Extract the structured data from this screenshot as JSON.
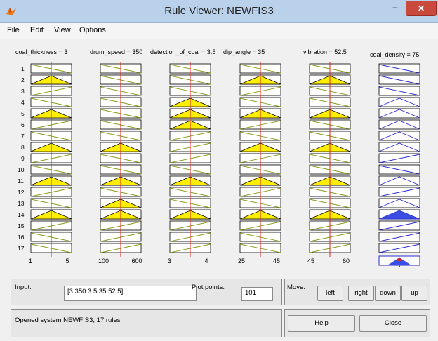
{
  "window": {
    "title": "Rule Viewer: NEWFIS3",
    "controls": {
      "minimize": "–",
      "maximize": "□",
      "close": "✕"
    }
  },
  "menu": [
    "File",
    "Edit",
    "View",
    "Options"
  ],
  "rule_count": 17,
  "inputs": [
    {
      "label": "coal_thickness = 3",
      "min": "1",
      "max": "5",
      "value": 3,
      "range": [
        1,
        5
      ]
    },
    {
      "label": "drum_speed = 350",
      "min": "100",
      "max": "600",
      "value": 350,
      "range": [
        100,
        600
      ]
    },
    {
      "label": "detection_of_coal = 3.5",
      "min": "3",
      "max": "4",
      "value": 3.5,
      "range": [
        3,
        4
      ]
    },
    {
      "label": "dip_angle = 35",
      "min": "25",
      "max": "45",
      "value": 35,
      "range": [
        25,
        45
      ]
    },
    {
      "label": "vibration = 52.5",
      "min": "45",
      "max": "60",
      "value": 52.5,
      "range": [
        45,
        60
      ]
    }
  ],
  "output": {
    "label": "coal_density = 75"
  },
  "rules_mf": [
    [
      "low",
      "low",
      "low",
      "low",
      "low"
    ],
    [
      "med",
      "low",
      "low",
      "med",
      "med"
    ],
    [
      "high",
      "low",
      "low",
      "high",
      "low"
    ],
    [
      "low",
      "low",
      "med",
      "low",
      "low"
    ],
    [
      "med",
      "low",
      "med",
      "med",
      "med"
    ],
    [
      "high",
      "low",
      "med",
      "high",
      "low"
    ],
    [
      "low",
      "low",
      "high",
      "low",
      "low"
    ],
    [
      "med",
      "med",
      "high",
      "med",
      "med"
    ],
    [
      "high",
      "low",
      "high",
      "high",
      "low"
    ],
    [
      "low",
      "low",
      "low",
      "low",
      "low"
    ],
    [
      "med",
      "med",
      "med",
      "med",
      "med"
    ],
    [
      "high",
      "low",
      "low",
      "high",
      "low"
    ],
    [
      "low",
      "med",
      "low",
      "low",
      "low"
    ],
    [
      "med",
      "med",
      "med",
      "med",
      "med"
    ],
    [
      "high",
      "high",
      "high",
      "high",
      "high"
    ],
    [
      "low",
      "high",
      "high",
      "low",
      "high"
    ],
    [
      "low",
      "high",
      "high",
      "low",
      "high"
    ]
  ],
  "output_mf": [
    "low",
    "low",
    "low",
    "med",
    "med",
    "med",
    "med",
    "med",
    "high",
    "low",
    "med",
    "high",
    "med",
    "fill-med",
    "high",
    "high",
    "high"
  ],
  "colors": {
    "fill": "#ffee00",
    "output_fill": "#3a4ee6",
    "line_in": "#8a9a18",
    "line_out": "#2b2bd0",
    "marker": "#e0241b"
  },
  "controls": {
    "input_label": "Input:",
    "input_value": "[3 350 3.5 35 52.5]",
    "plot_points_label": "Plot points:",
    "plot_points_value": "101",
    "move_label": "Move:",
    "left_label": "left",
    "right_label": "right",
    "down_label": "down",
    "up_label": "up",
    "status_text": "Opened system NEWFIS3, 17 rules",
    "help_label": "Help",
    "close_label": "Close"
  }
}
